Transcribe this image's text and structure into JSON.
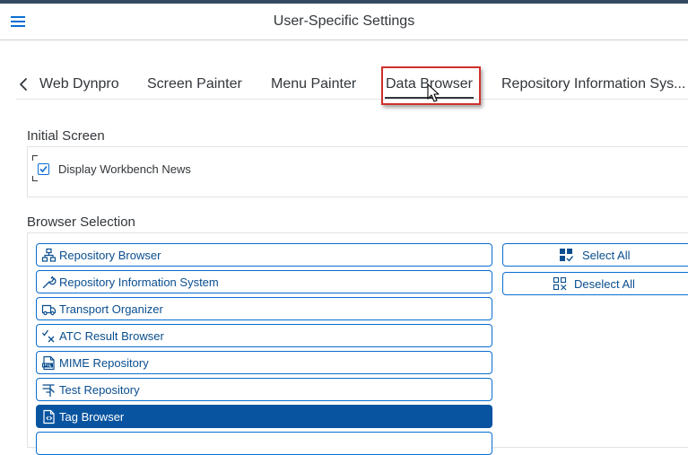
{
  "header": {
    "title": "User-Specific Settings",
    "menu_icon": "hamburger-icon"
  },
  "tabs": [
    {
      "label": "Web Dynpro"
    },
    {
      "label": "Screen Painter"
    },
    {
      "label": "Menu Painter"
    },
    {
      "label": "Data Browser",
      "selected": true
    },
    {
      "label": "Repository Information Sys..."
    }
  ],
  "initial_screen": {
    "title": "Initial Screen",
    "checkbox": {
      "label": "Display Workbench News",
      "checked": true
    }
  },
  "browser_selection": {
    "title": "Browser Selection",
    "items": [
      {
        "label": "Repository Browser",
        "icon": "hierarchy-icon"
      },
      {
        "label": "Repository Information System",
        "icon": "wrench-icon"
      },
      {
        "label": "Transport Organizer",
        "icon": "truck-icon"
      },
      {
        "label": "ATC Result Browser",
        "icon": "check-cross-icon"
      },
      {
        "label": "MIME Repository",
        "icon": "bmp-file-icon"
      },
      {
        "label": "Test Repository",
        "icon": "test-list-icon"
      },
      {
        "label": "Tag Browser",
        "icon": "tag-document-icon",
        "selected": true
      }
    ],
    "select_all": "Select All",
    "deselect_all": "Deselect All"
  },
  "colors": {
    "accent": "#0a6ed1",
    "selected_bg": "#0854a0",
    "highlight_box": "#d0312d",
    "shell_bar": "#354a5f"
  }
}
